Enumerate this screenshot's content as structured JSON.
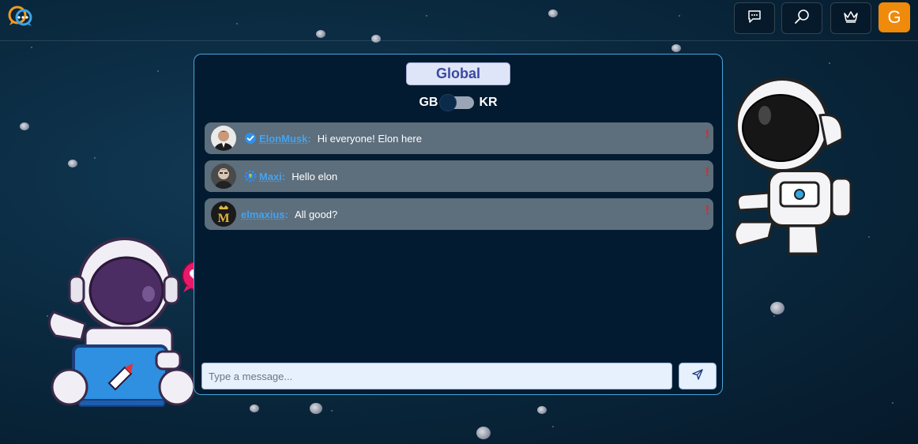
{
  "topbar": {
    "logo_icon": "chat-bubbles-logo",
    "buttons": [
      {
        "name": "messages-button",
        "icon": "chat-icon"
      },
      {
        "name": "search-button",
        "icon": "search-icon"
      },
      {
        "name": "crown-button",
        "icon": "crown-icon"
      }
    ],
    "profile_initial": "G",
    "profile_color": "#f08a0b"
  },
  "chat": {
    "room_title": "Global",
    "lang_left": "GB",
    "lang_right": "KR",
    "messages": [
      {
        "user": "ElonMusk",
        "colon": ":",
        "text": "Hi everyone! Elon here",
        "badge": "verified-icon",
        "report": "!"
      },
      {
        "user": "Maxi",
        "colon": ":",
        "text": "Hello elon",
        "badge": "gear-badge-icon",
        "report": "!"
      },
      {
        "user": "elmaxius",
        "colon": ":",
        "text": "All good?",
        "badge": "",
        "report": "!"
      }
    ],
    "input_placeholder": "Type a message...",
    "send_icon": "send-icon"
  },
  "colors": {
    "panel_bg": "#021b30",
    "panel_border": "#4aa3d8",
    "message_bg": "#5d6e7c",
    "username": "#43a3f0",
    "report": "#e02828"
  }
}
